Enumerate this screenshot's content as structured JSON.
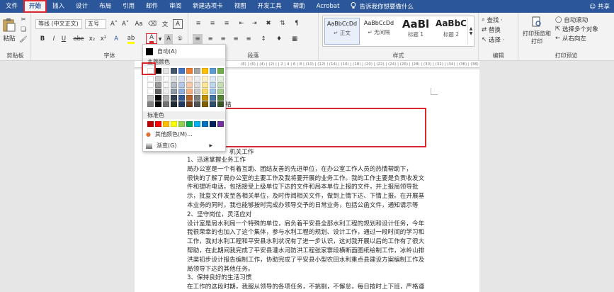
{
  "menu": {
    "items": [
      "文件",
      "开始",
      "插入",
      "设计",
      "布局",
      "引用",
      "邮件",
      "审阅",
      "新建选项卡",
      "视图",
      "开发工具",
      "帮助",
      "Acrobat"
    ],
    "active": "开始",
    "tell_me": "告诉我你想要做什么",
    "share": "共享"
  },
  "ribbon": {
    "clipboard": {
      "paste_label": "粘贴",
      "group_label": "剪贴板"
    },
    "font": {
      "font_name": "等线 (中文正文)",
      "font_size": "五号",
      "bold": "B",
      "italic": "I",
      "underline": "U",
      "strike": "abc",
      "subscript": "x₂",
      "superscript": "x²",
      "grow": "A˄",
      "shrink": "A˅",
      "case": "Aa",
      "font_color_glyph": "A",
      "group_label": "字体"
    },
    "paragraph": {
      "group_label": "段落"
    },
    "styles": {
      "items": [
        {
          "sample": "AaBbCcDd",
          "name": "↵ 正文"
        },
        {
          "sample": "AaBbCcDd",
          "name": "↵ 无间隔"
        },
        {
          "sample": "AaBl",
          "name": "标题 1"
        },
        {
          "sample": "AaBbC",
          "name": "标题 2"
        }
      ],
      "group_label": "样式"
    },
    "editing": {
      "find": "查找 ·",
      "replace": "替换",
      "select": "选择 ·",
      "group_label": "编辑"
    },
    "print_preview": {
      "print_btn": "打印预览和打印",
      "auto_scroll": "自动滚动",
      "select_objects": "选择多个对象",
      "rtl": "从右向左",
      "group_label": "打印预览"
    }
  },
  "ruler_text": "(8) | (6) | (4) | (2) | | 2 | 4 | 6 | 8 | (10) | (12) | (14) | (16) | (18) | (20) | (22) | (24) | (26) | (28) | (30) | (32) | (34) | (36) | (38) | (40) | (42) | (44) | (46) | (48)",
  "color_menu": {
    "auto": "自动(A)",
    "theme_label": "主题颜色",
    "standard_label": "标准色",
    "more_colors": "其他颜色(M)...",
    "gradient": "渐变(G)",
    "theme_top": [
      "#ffffff",
      "#000000",
      "#e7e6e6",
      "#44546a",
      "#4472c4",
      "#ed7d31",
      "#a5a5a5",
      "#ffc000",
      "#5b9bd5",
      "#70ad47"
    ],
    "standard": [
      "#c00000",
      "#ff0000",
      "#ffc000",
      "#ffff00",
      "#92d050",
      "#00b050",
      "#00b0f0",
      "#0070c0",
      "#002060",
      "#7030a0"
    ]
  },
  "document": {
    "fragment_top": "结",
    "fragment_heading": "机关工作",
    "lines": [
      "1、迅速掌握业务工作",
      "局办公室是一个有着互助、团结友善的先进单位，在办公室工作人员的热情帮助下，",
      "很快的了解了局办公室的主要工作及我将要开展的业务工作。我的工作主要是负责收发文",
      "件和提听电话，包括接受上级单位下达的文件和局本单位上报的文件，并上报局领导批",
      "示，批复文件发至各相关单位，及时传阅相关文件，做到上情下达、下情上报。在开展基",
      "本业务的同时，我也能够按时完成办领导交予的日常业务，包括公函文件，通知请示等",
      "2、坚守岗位，灵活应对",
      "设计室是局水利局一个特殊的单位，肩负着平安县全部水利工程的规划和设计任务，今年",
      "我很荣幸的也加入了这个集体，参与水利工程的规划、设计工作，通过一段时间的学习和",
      "工作，我对水利工程和平安县水利状况有了进一步认识，这对我开展以后的工作有了很大",
      "帮助，在此期间我完成了平安县灌水河防洪工程张家寨段横断面图纸绘制工作，冰岭山排",
      "洪渠初步设计报告编制工作，协助完成了平安县小型农田水利重点县建设方案编制工作及",
      "局领导下达的其他任务。",
      "3、保持良好的生活习惯",
      "在工作的这段时期，我服从领导的各项任务，不挑剔，不懈怠，每日按时上下班，严格遵"
    ]
  }
}
